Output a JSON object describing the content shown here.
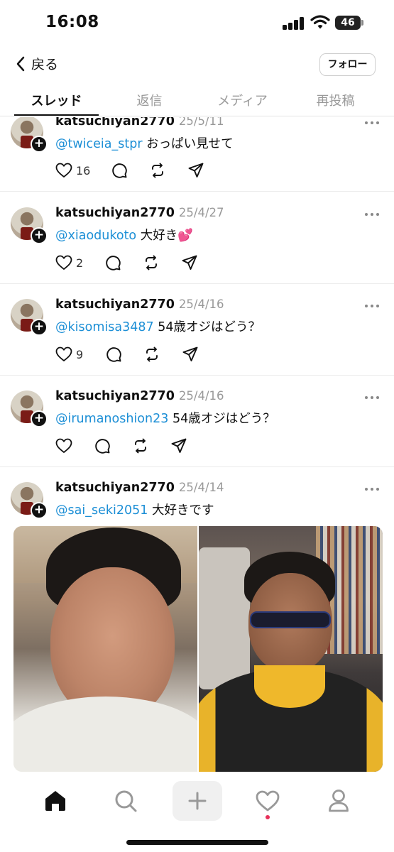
{
  "status_bar": {
    "time": "16:08",
    "battery": "46"
  },
  "header": {
    "back_label": "戻る",
    "follow_label": "フォロー"
  },
  "tabs": [
    {
      "label": "スレッド",
      "active": true
    },
    {
      "label": "返信",
      "active": false
    },
    {
      "label": "メディア",
      "active": false
    },
    {
      "label": "再投稿",
      "active": false
    }
  ],
  "posts": [
    {
      "username": "katsuchiyan2770",
      "date": "25/5/11",
      "mention": "@twiceia_stpr",
      "text": "おっぱい見せて",
      "like_count": "16"
    },
    {
      "username": "katsuchiyan2770",
      "date": "25/4/27",
      "mention": "@xiaodukoto",
      "text": "大好き💕",
      "like_count": "2"
    },
    {
      "username": "katsuchiyan2770",
      "date": "25/4/16",
      "mention": "@kisomisa3487",
      "text": "54歳オジはどう？",
      "like_count": "9"
    },
    {
      "username": "katsuchiyan2770",
      "date": "25/4/16",
      "mention": "@irumanoshion23",
      "text": "54歳オジはどう？",
      "like_count": ""
    },
    {
      "username": "katsuchiyan2770",
      "date": "25/4/14",
      "mention": "@sai_seki2051",
      "text": "大好きです",
      "like_count": ""
    }
  ],
  "icons": {
    "back": "chevron-left-icon",
    "like": "heart-icon",
    "reply": "comment-icon",
    "repost": "repost-icon",
    "share": "send-icon",
    "more": "more-icon",
    "home": "home-icon",
    "search": "search-icon",
    "create": "plus-icon",
    "activity": "heart-icon",
    "profile": "profile-icon"
  },
  "colors": {
    "mention": "#1d8fd6",
    "notification_dot": "#e8305a"
  }
}
